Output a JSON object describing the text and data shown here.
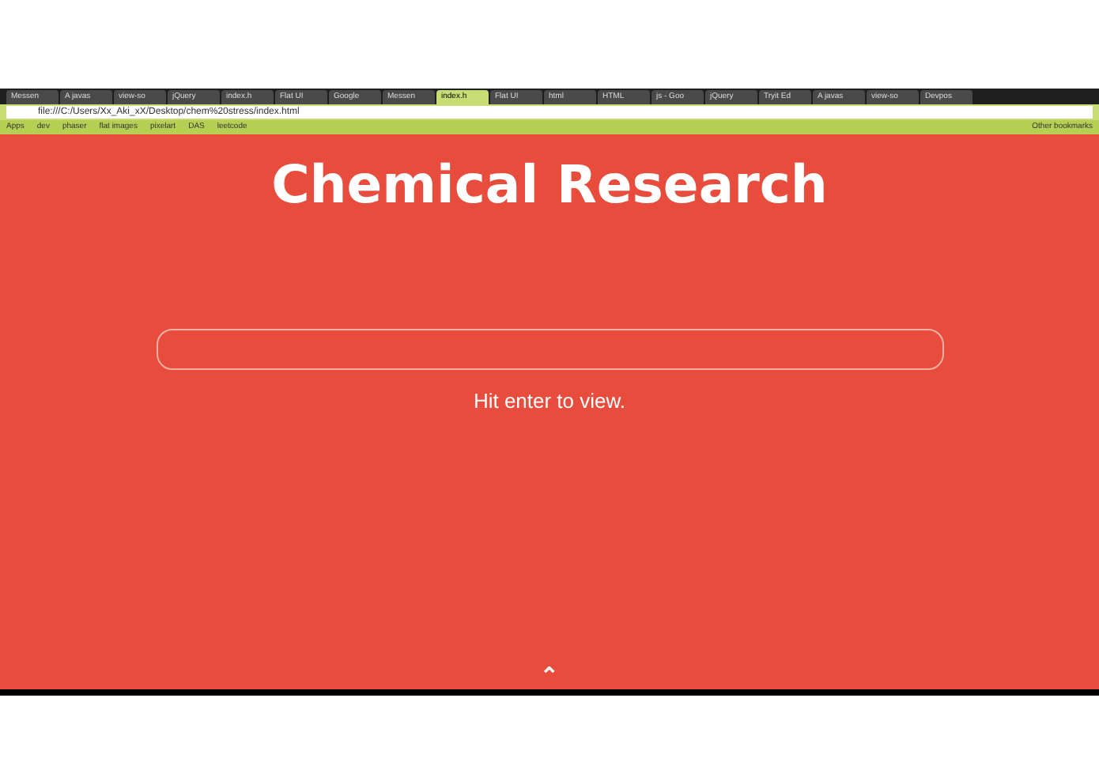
{
  "tabs": [
    {
      "label": "Messen",
      "selected": false
    },
    {
      "label": "A javas",
      "selected": false
    },
    {
      "label": "view-so",
      "selected": false
    },
    {
      "label": "jQuery",
      "selected": false
    },
    {
      "label": "index.h",
      "selected": false
    },
    {
      "label": "Flat UI",
      "selected": false
    },
    {
      "label": "Google",
      "selected": false
    },
    {
      "label": "Messen",
      "selected": false
    },
    {
      "label": "index.h",
      "selected": true
    },
    {
      "label": "Flat UI",
      "selected": false
    },
    {
      "label": "html",
      "selected": false
    },
    {
      "label": "HTML",
      "selected": false
    },
    {
      "label": "js - Goo",
      "selected": false
    },
    {
      "label": "jQuery",
      "selected": false
    },
    {
      "label": "Tryit Ed",
      "selected": false
    },
    {
      "label": "A javas",
      "selected": false
    },
    {
      "label": "view-so",
      "selected": false
    },
    {
      "label": "Devpos",
      "selected": false
    }
  ],
  "address": "file:///C:/Users/Xx_Aki_xX/Desktop/chem%20stress/index.html",
  "bookmarks": [
    "Apps",
    "dev",
    "phaser",
    "flat images",
    "pixelart",
    "DAS",
    "leetcode"
  ],
  "other_bookmarks": "Other bookmarks",
  "page": {
    "title": "Chemical Research",
    "hint": "Hit enter to view.",
    "scroll_up": "⌃"
  }
}
